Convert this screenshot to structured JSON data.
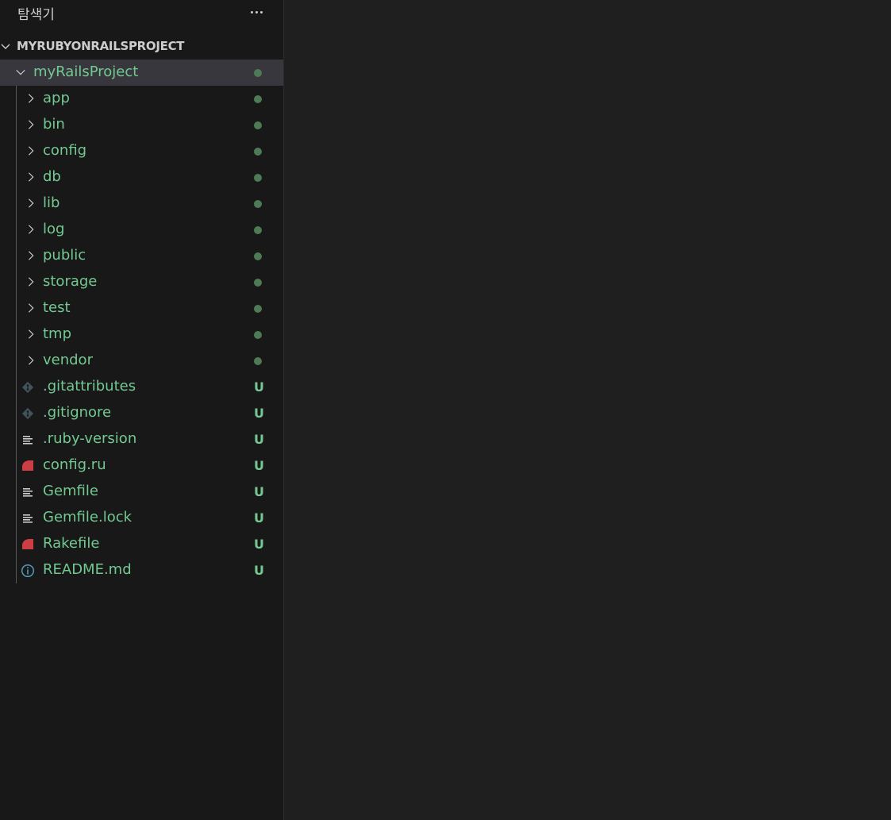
{
  "title": "탐색기",
  "workspace": "MYRUBYONRAILSPROJECT",
  "root": {
    "label": "myRailsProject"
  },
  "folders": [
    {
      "label": "app"
    },
    {
      "label": "bin"
    },
    {
      "label": "config"
    },
    {
      "label": "db"
    },
    {
      "label": "lib"
    },
    {
      "label": "log"
    },
    {
      "label": "public"
    },
    {
      "label": "storage"
    },
    {
      "label": "test"
    },
    {
      "label": "tmp"
    },
    {
      "label": "vendor"
    }
  ],
  "files": [
    {
      "label": ".gitattributes",
      "icon": "git-icon",
      "badge": "U"
    },
    {
      "label": ".gitignore",
      "icon": "git-icon",
      "badge": "U"
    },
    {
      "label": ".ruby-version",
      "icon": "text-lines-icon",
      "badge": "U"
    },
    {
      "label": "config.ru",
      "icon": "ruby-icon",
      "badge": "U"
    },
    {
      "label": "Gemfile",
      "icon": "text-lines-icon",
      "badge": "U"
    },
    {
      "label": "Gemfile.lock",
      "icon": "text-lines-icon",
      "badge": "U"
    },
    {
      "label": "Rakefile",
      "icon": "ruby-icon",
      "badge": "U"
    },
    {
      "label": "README.md",
      "icon": "info-icon",
      "badge": "U"
    }
  ],
  "colors": {
    "untracked": "#73c991",
    "modified_dot": "#4e7a55",
    "selection": "#37373d",
    "ruby": "#cc3e44",
    "info": "#519aba",
    "git": "#41535b"
  }
}
